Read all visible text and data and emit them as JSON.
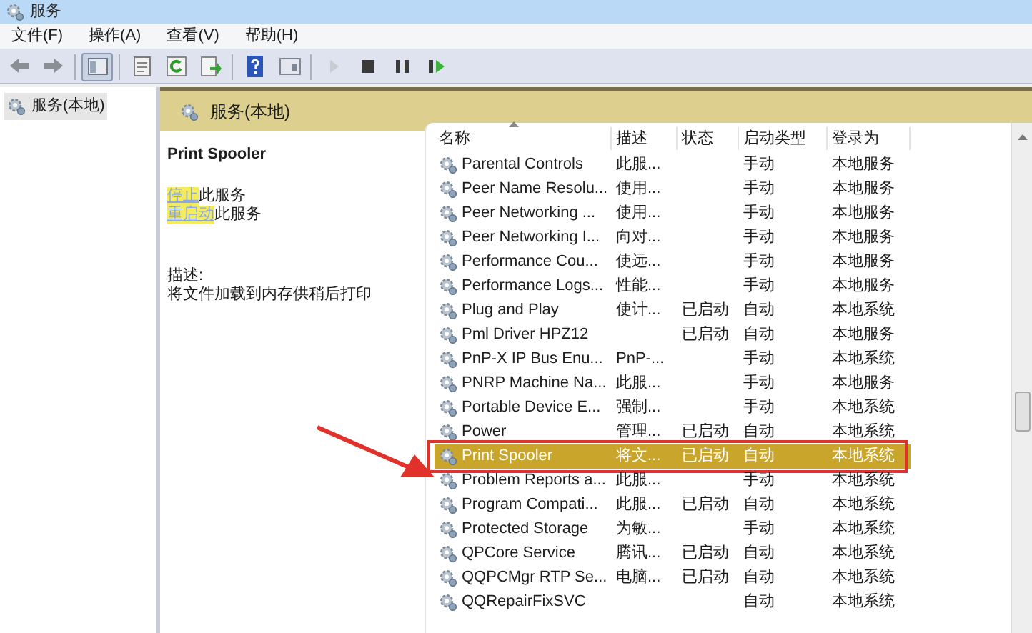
{
  "window": {
    "title": "服务"
  },
  "menu": [
    "文件(F)",
    "操作(A)",
    "查看(V)",
    "帮助(H)"
  ],
  "toolbar": [
    {
      "kind": "back",
      "disabled": false
    },
    {
      "kind": "forward",
      "disabled": false
    },
    {
      "kind": "sep"
    },
    {
      "kind": "tree",
      "disabled": false,
      "selected": true
    },
    {
      "kind": "sep"
    },
    {
      "kind": "properties",
      "disabled": false
    },
    {
      "kind": "refresh",
      "disabled": false
    },
    {
      "kind": "export",
      "disabled": false
    },
    {
      "kind": "sep"
    },
    {
      "kind": "help",
      "disabled": false
    },
    {
      "kind": "view",
      "disabled": false
    },
    {
      "kind": "sep"
    },
    {
      "kind": "start",
      "disabled": true
    },
    {
      "kind": "stop",
      "disabled": false
    },
    {
      "kind": "pause",
      "disabled": false
    },
    {
      "kind": "resume",
      "disabled": false
    }
  ],
  "tree": {
    "items": [
      {
        "label": "服务(本地)",
        "selected": true
      }
    ]
  },
  "panel": {
    "header": "服务(本地)"
  },
  "details": {
    "service_name": "Print Spooler",
    "actions": [
      {
        "link": "停止",
        "text": "此服务"
      },
      {
        "link": "重启动",
        "text": "此服务"
      }
    ],
    "description_label": "描述:",
    "description": "将文件加载到内存供稍后打印"
  },
  "table": {
    "columns": [
      "名称",
      "描述",
      "状态",
      "启动类型",
      "登录为"
    ],
    "rows": [
      {
        "name": "Parental Controls",
        "description": "此服...",
        "status": "",
        "startup": "手动",
        "logon": "本地服务",
        "selected": false
      },
      {
        "name": "Peer Name Resolu...",
        "description": "使用...",
        "status": "",
        "startup": "手动",
        "logon": "本地服务",
        "selected": false
      },
      {
        "name": "Peer Networking ...",
        "description": "使用...",
        "status": "",
        "startup": "手动",
        "logon": "本地服务",
        "selected": false
      },
      {
        "name": "Peer Networking I...",
        "description": "向对...",
        "status": "",
        "startup": "手动",
        "logon": "本地服务",
        "selected": false
      },
      {
        "name": "Performance Cou...",
        "description": "使远...",
        "status": "",
        "startup": "手动",
        "logon": "本地服务",
        "selected": false
      },
      {
        "name": "Performance Logs...",
        "description": "性能...",
        "status": "",
        "startup": "手动",
        "logon": "本地服务",
        "selected": false
      },
      {
        "name": "Plug and Play",
        "description": "使计...",
        "status": "已启动",
        "startup": "自动",
        "logon": "本地系统",
        "selected": false
      },
      {
        "name": "Pml Driver HPZ12",
        "description": "",
        "status": "已启动",
        "startup": "自动",
        "logon": "本地服务",
        "selected": false
      },
      {
        "name": "PnP-X IP Bus Enu...",
        "description": "PnP-...",
        "status": "",
        "startup": "手动",
        "logon": "本地系统",
        "selected": false
      },
      {
        "name": "PNRP Machine Na...",
        "description": "此服...",
        "status": "",
        "startup": "手动",
        "logon": "本地服务",
        "selected": false
      },
      {
        "name": "Portable Device E...",
        "description": "强制...",
        "status": "",
        "startup": "手动",
        "logon": "本地系统",
        "selected": false
      },
      {
        "name": "Power",
        "description": "管理...",
        "status": "已启动",
        "startup": "自动",
        "logon": "本地系统",
        "selected": false
      },
      {
        "name": "Print Spooler",
        "description": "将文...",
        "status": "已启动",
        "startup": "自动",
        "logon": "本地系统",
        "selected": true
      },
      {
        "name": "Problem Reports a...",
        "description": "此服...",
        "status": "",
        "startup": "手动",
        "logon": "本地系统",
        "selected": false
      },
      {
        "name": "Program Compati...",
        "description": "此服...",
        "status": "已启动",
        "startup": "自动",
        "logon": "本地系统",
        "selected": false
      },
      {
        "name": "Protected Storage",
        "description": "为敏...",
        "status": "",
        "startup": "手动",
        "logon": "本地系统",
        "selected": false
      },
      {
        "name": "QPCore Service",
        "description": "腾讯...",
        "status": "已启动",
        "startup": "自动",
        "logon": "本地系统",
        "selected": false
      },
      {
        "name": "QQPCMgr RTP Se...",
        "description": "电脑...",
        "status": "已启动",
        "startup": "自动",
        "logon": "本地系统",
        "selected": false
      },
      {
        "name": "QQRepairFixSVC",
        "description": "",
        "status": "",
        "startup": "自动",
        "logon": "本地系统",
        "selected": false
      }
    ]
  }
}
